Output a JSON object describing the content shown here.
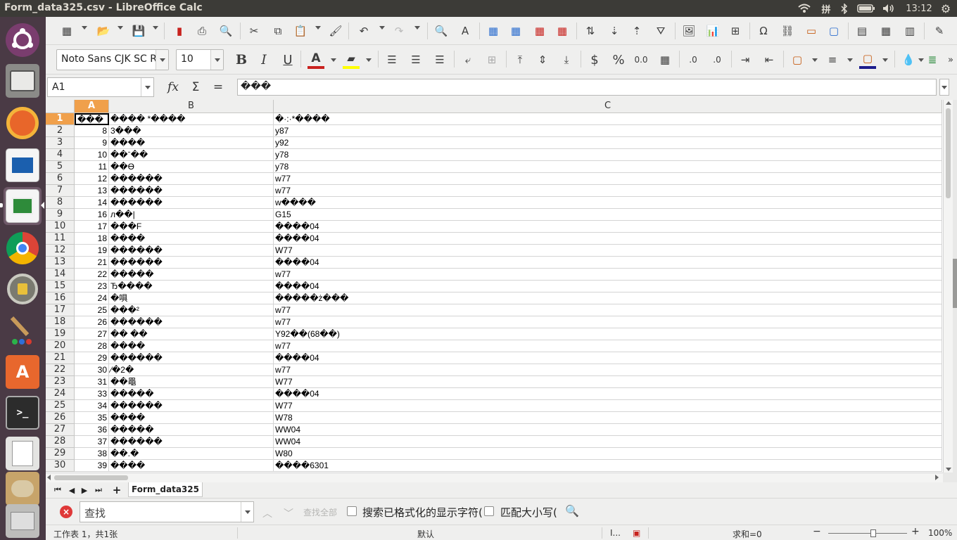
{
  "window": {
    "title": "Form_data325.csv - LibreOffice Calc",
    "ime": "拼",
    "clock": "13:12"
  },
  "toolbar2": {
    "font_name": "Noto Sans CJK SC R",
    "font_size": "10",
    "font_color": "#c9211e",
    "highlight_color": "#ffff00",
    "border_color": "#c55a11",
    "bg_color": "#1c1c8c"
  },
  "formula_bar": {
    "name_box": "A1",
    "fx": "fx",
    "sum": "Σ",
    "equals": "=",
    "content": "���"
  },
  "columns": [
    {
      "label": "A",
      "selected": true
    },
    {
      "label": "B",
      "selected": false
    },
    {
      "label": "C",
      "selected": false
    }
  ],
  "rows": [
    {
      "n": "1",
      "a": "���",
      "b": "���� *����",
      "c": "�·:·*����"
    },
    {
      "n": "2",
      "a": "8",
      "b": "3���",
      "c": "y87"
    },
    {
      "n": "3",
      "a": "9",
      "b": "����",
      "c": "y92"
    },
    {
      "n": "4",
      "a": "10",
      "b": "��ˉ��",
      "c": "y78"
    },
    {
      "n": "5",
      "a": "11",
      "b": "��ϴ",
      "c": "y78"
    },
    {
      "n": "6",
      "a": "12",
      "b": "������",
      "c": "w77"
    },
    {
      "n": "7",
      "a": "13",
      "b": "������",
      "c": "w77"
    },
    {
      "n": "8",
      "a": "14",
      "b": "������",
      "c": "w����"
    },
    {
      "n": "9",
      "a": "16",
      "b": "л��|",
      "c": "G15"
    },
    {
      "n": "10",
      "a": "17",
      "b": "���F",
      "c": "����04"
    },
    {
      "n": "11",
      "a": "18",
      "b": "����",
      "c": "����04"
    },
    {
      "n": "12",
      "a": "19",
      "b": "������",
      "c": "W77"
    },
    {
      "n": "13",
      "a": "21",
      "b": "������",
      "c": "����04"
    },
    {
      "n": "14",
      "a": "22",
      "b": "�����",
      "c": "w77"
    },
    {
      "n": "15",
      "a": "23",
      "b": "Ђ����",
      "c": "����04"
    },
    {
      "n": "16",
      "a": "24",
      "b": "�㖵",
      "c": "�����ż���"
    },
    {
      "n": "17",
      "a": "25",
      "b": "���²",
      "c": "w77"
    },
    {
      "n": "18",
      "a": "26",
      "b": "������",
      "c": "w77"
    },
    {
      "n": "19",
      "a": "27",
      "b": "��  ��",
      "c": "Y92��(68��)"
    },
    {
      "n": "20",
      "a": "28",
      "b": "����",
      "c": "w77"
    },
    {
      "n": "21",
      "a": "29",
      "b": "������",
      "c": "����04"
    },
    {
      "n": "22",
      "a": "30",
      "b": "⁄�2�",
      "c": "w77"
    },
    {
      "n": "23",
      "a": "31",
      "b": "��黽",
      "c": "W77"
    },
    {
      "n": "24",
      "a": "33",
      "b": "�����",
      "c": "����04"
    },
    {
      "n": "25",
      "a": "34",
      "b": "������",
      "c": "W77"
    },
    {
      "n": "26",
      "a": "35",
      "b": "����",
      "c": "W78"
    },
    {
      "n": "27",
      "a": "36",
      "b": "�����",
      "c": "WW04"
    },
    {
      "n": "28",
      "a": "37",
      "b": "������",
      "c": "WW04"
    },
    {
      "n": "29",
      "a": "38",
      "b": "��.�",
      "c": "W80"
    },
    {
      "n": "30",
      "a": "39",
      "b": "����",
      "c": "����6301"
    }
  ],
  "sheet_tab": "Form_data325",
  "find_bar": {
    "placeholder": "查找",
    "find_all": "查找全部",
    "formatted_label": "搜索已格式化的显示字符(",
    "match_case_label": "匹配大小写("
  },
  "status_bar": {
    "sheet_info": "工作表 1，共1张",
    "page_style": "默认",
    "selection_mode": "I...",
    "sum": "求和=0",
    "zoom": "100%"
  }
}
